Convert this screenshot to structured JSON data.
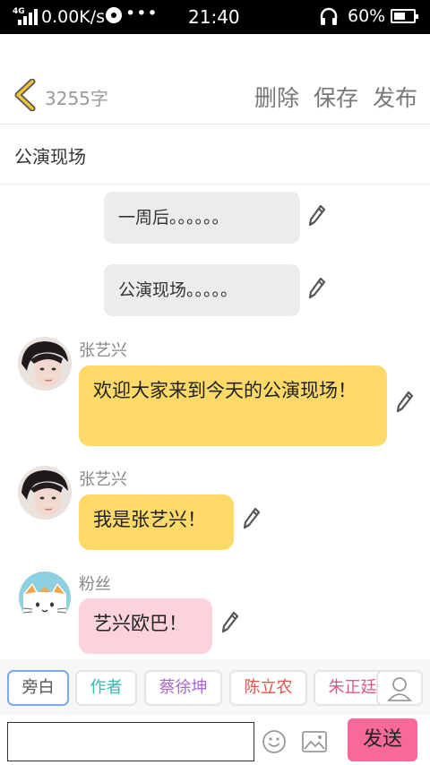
{
  "status_bar": {
    "network": "4G",
    "speed": "0.00K/s",
    "dots": "•••",
    "time": "21:40",
    "battery": "60%"
  },
  "header": {
    "word_count": "3255字",
    "delete_label": "删除",
    "save_label": "保存",
    "publish_label": "发布"
  },
  "title": "公演现场",
  "messages": [
    {
      "type": "narration",
      "text": "一周后。。。。。。"
    },
    {
      "type": "narration",
      "text": "公演现场。。。。。"
    },
    {
      "type": "chat",
      "speaker": "张艺兴",
      "text": "欢迎大家来到今天的公演现场！"
    },
    {
      "type": "chat",
      "speaker": "张艺兴",
      "text": "我是张艺兴！"
    },
    {
      "type": "chat",
      "speaker": "粉丝",
      "text": "艺兴欧巴！"
    }
  ],
  "roles": [
    {
      "label": "旁白",
      "color": "#555555"
    },
    {
      "label": "作者",
      "color": "#36b8b0"
    },
    {
      "label": "蔡徐坤",
      "color": "#a86ad0"
    },
    {
      "label": "陈立农",
      "color": "#e0564e"
    },
    {
      "label": "朱正廷",
      "color": "#e0568a"
    }
  ],
  "input": {
    "value": "",
    "placeholder": ""
  },
  "send_label": "发送",
  "colors": {
    "chat_bubble": "#fcd968",
    "fan_bubble": "#fcd2dc",
    "narration_bubble": "#ececec",
    "send_button": "#f7699a",
    "back_arrow": "#f2c43a"
  }
}
